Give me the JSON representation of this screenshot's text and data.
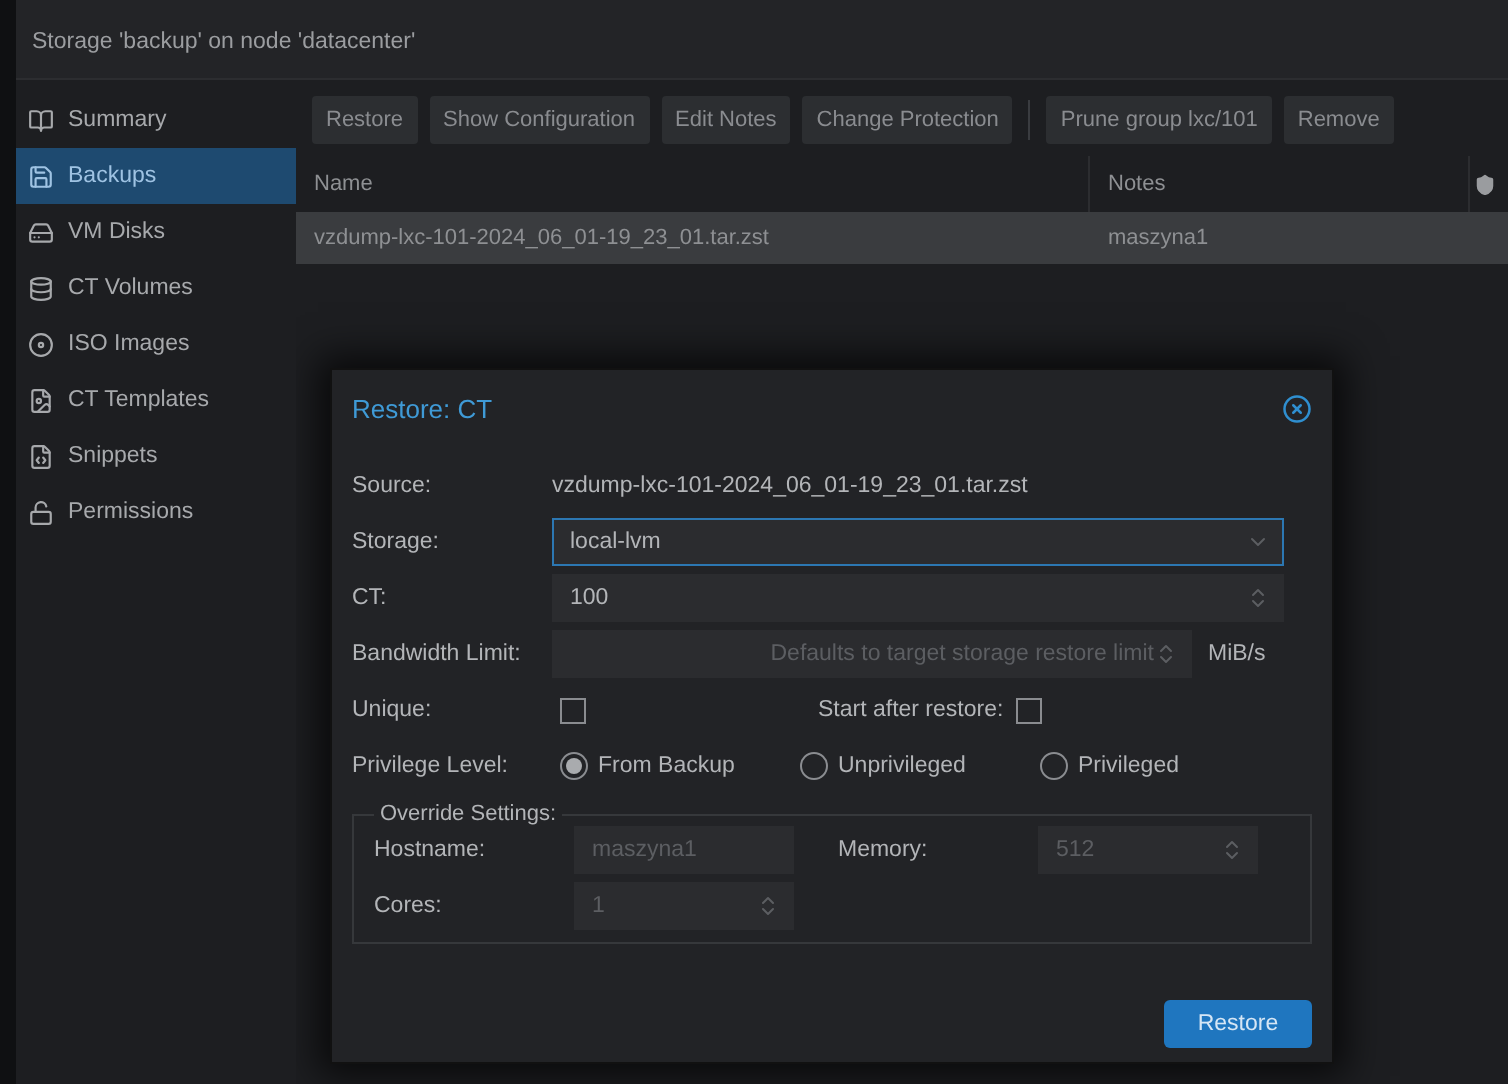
{
  "window": {
    "title": "Storage 'backup' on node 'datacenter'"
  },
  "sidebar": {
    "items": [
      {
        "label": "Summary",
        "selected": false
      },
      {
        "label": "Backups",
        "selected": true
      },
      {
        "label": "VM Disks",
        "selected": false
      },
      {
        "label": "CT Volumes",
        "selected": false
      },
      {
        "label": "ISO Images",
        "selected": false
      },
      {
        "label": "CT Templates",
        "selected": false
      },
      {
        "label": "Snippets",
        "selected": false
      },
      {
        "label": "Permissions",
        "selected": false
      }
    ]
  },
  "toolbar": {
    "groups": [
      [
        "Restore",
        "Show Configuration",
        "Edit Notes",
        "Change Protection"
      ],
      [
        "Prune group lxc/101",
        "Remove"
      ]
    ]
  },
  "table": {
    "columns": [
      {
        "kind": "text",
        "label": "Name"
      },
      {
        "kind": "text",
        "label": "Notes"
      },
      {
        "kind": "icon"
      }
    ],
    "rows": [
      {
        "cells": [
          "vzdump-lxc-101-2024_06_01-19_23_01.tar.zst",
          "maszyna1"
        ],
        "selected": true
      }
    ]
  },
  "dialog": {
    "title": "Restore: CT",
    "source": {
      "label": "Source:",
      "value": "vzdump-lxc-101-2024_06_01-19_23_01.tar.zst"
    },
    "storage": {
      "label": "Storage:",
      "value": "local-lvm",
      "focused": true
    },
    "ct": {
      "label": "CT:",
      "value": "100"
    },
    "bandwidth": {
      "label": "Bandwidth Limit:",
      "placeholder": "Defaults to target storage restore limit",
      "unit": "MiB/s"
    },
    "unique": {
      "label": "Unique:",
      "checked": false
    },
    "start_after_restore": {
      "label": "Start after restore:",
      "checked": false
    },
    "privilege": {
      "label": "Privilege Level:",
      "options": [
        {
          "label": "From Backup",
          "selected": true
        },
        {
          "label": "Unprivileged",
          "selected": false
        },
        {
          "label": "Privileged",
          "selected": false
        }
      ]
    },
    "override": {
      "legend": "Override Settings:",
      "hostname": {
        "label": "Hostname:",
        "placeholder": "maszyna1"
      },
      "memory": {
        "label": "Memory:",
        "placeholder": "512"
      },
      "cores": {
        "label": "Cores:",
        "placeholder": "1"
      }
    },
    "buttons": [
      "Restore"
    ]
  }
}
